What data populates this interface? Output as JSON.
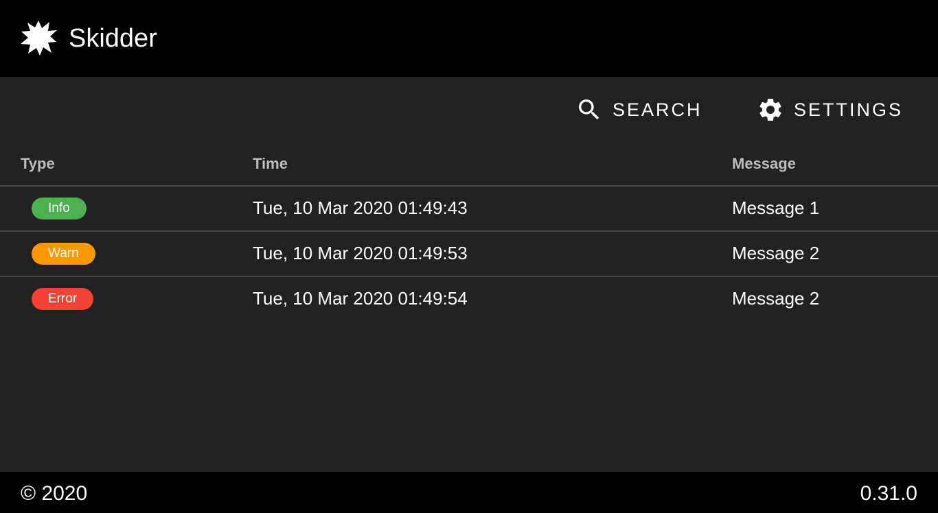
{
  "appbar": {
    "title": "Skidder",
    "logo_icon": "splat-logo-icon"
  },
  "toolbar": {
    "search_label": "SEARCH",
    "search_icon": "search-icon",
    "settings_label": "SETTINGS",
    "settings_icon": "gear-icon"
  },
  "table": {
    "columns": [
      "Type",
      "Time",
      "Message"
    ],
    "rows": [
      {
        "type": "Info",
        "type_color": "#4caf50",
        "time": "Tue, 10 Mar 2020 01:49:43",
        "message": "Message 1"
      },
      {
        "type": "Warn",
        "type_color": "#ff9800",
        "time": "Tue, 10 Mar 2020 01:49:53",
        "message": "Message 2"
      },
      {
        "type": "Error",
        "type_color": "#f44336",
        "time": "Tue, 10 Mar 2020 01:49:54",
        "message": "Message 2"
      }
    ]
  },
  "footer": {
    "copyright": "© 2020",
    "version": "0.31.0"
  },
  "colors": {
    "appbar_bg": "#000000",
    "page_bg": "#212121",
    "header_text": "#bdbdbd"
  }
}
